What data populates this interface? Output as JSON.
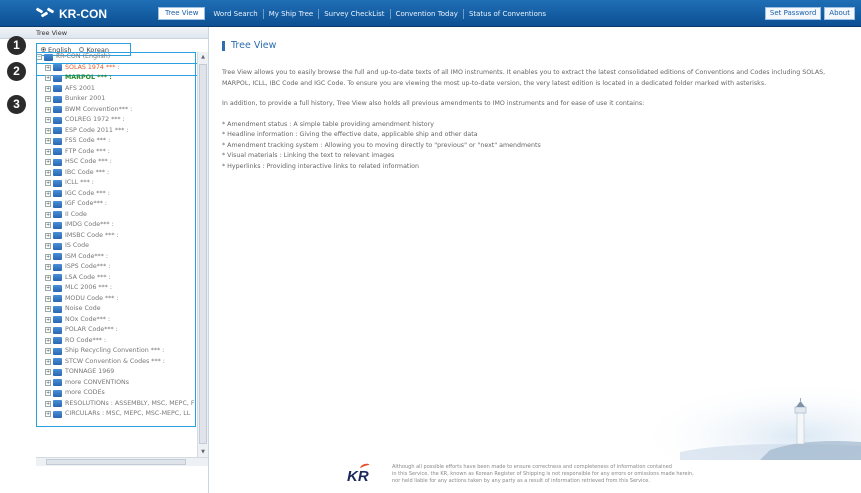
{
  "app": {
    "name": "KR-CON"
  },
  "nav": {
    "items": [
      "Tree View",
      "Word Search",
      "My Ship Tree",
      "Survey CheckList",
      "Convention Today",
      "Status of Conventions"
    ],
    "active": "Tree View"
  },
  "top_right": {
    "set_password": "Set Password",
    "about": "About"
  },
  "left": {
    "title": "Tree View",
    "lang_options": [
      "English",
      "Korean"
    ],
    "lang_selected": "English",
    "search_placeholder": "",
    "markers": [
      "1",
      "2",
      "3"
    ],
    "tree": {
      "root": "KR-CON (English)",
      "items": [
        {
          "label": "SOLAS 1974 *** :",
          "color": "red"
        },
        {
          "label": "MARPOL *** :",
          "color": "green"
        },
        {
          "label": "AFS 2001",
          "color": "gray"
        },
        {
          "label": "Bunker 2001",
          "color": "gray"
        },
        {
          "label": "BWM Convention*** :",
          "color": "gray"
        },
        {
          "label": "COLREG 1972 *** :",
          "color": "gray"
        },
        {
          "label": "ESP Code 2011 *** :",
          "color": "gray"
        },
        {
          "label": "FSS Code *** :",
          "color": "gray"
        },
        {
          "label": "FTP Code *** :",
          "color": "gray"
        },
        {
          "label": "HSC Code *** :",
          "color": "gray"
        },
        {
          "label": "IBC Code *** :",
          "color": "gray"
        },
        {
          "label": "ICLL *** :",
          "color": "gray"
        },
        {
          "label": "IGC Code *** :",
          "color": "gray"
        },
        {
          "label": "IGF Code*** :",
          "color": "gray"
        },
        {
          "label": "II Code",
          "color": "gray"
        },
        {
          "label": "IMDG Code*** :",
          "color": "gray"
        },
        {
          "label": "IMSBC Code *** :",
          "color": "gray"
        },
        {
          "label": "IS Code",
          "color": "gray"
        },
        {
          "label": "ISM Code*** :",
          "color": "gray"
        },
        {
          "label": "ISPS Code*** :",
          "color": "gray"
        },
        {
          "label": "LSA Code *** :",
          "color": "gray"
        },
        {
          "label": "MLC 2006 *** :",
          "color": "gray"
        },
        {
          "label": "MODU Code *** :",
          "color": "gray"
        },
        {
          "label": "Noise Code",
          "color": "gray"
        },
        {
          "label": "NOx Code*** :",
          "color": "gray"
        },
        {
          "label": "POLAR Code*** :",
          "color": "gray"
        },
        {
          "label": "RO Code*** :",
          "color": "gray"
        },
        {
          "label": "Ship Recycling Convention *** :",
          "color": "gray"
        },
        {
          "label": "STCW Convention & Codes *** :",
          "color": "gray"
        },
        {
          "label": "TONNAGE 1969",
          "color": "gray"
        },
        {
          "label": "more CONVENTIONs",
          "color": "gray"
        },
        {
          "label": "more CODEs",
          "color": "gray"
        },
        {
          "label": "RESOLUTIONs : ASSEMBLY, MSC, MEPC, F",
          "color": "gray"
        },
        {
          "label": "CIRCULARs : MSC, MEPC, MSC-MEPC, LL",
          "color": "gray"
        }
      ]
    }
  },
  "content": {
    "title": "Tree View",
    "paragraph1": "Tree View allows you to easily browse the full and up-to-date texts of all IMO instruments. It enables you to extract the latest consolidated editions of Conventions and Codes including SOLAS, MARPOL, ICLL, IBC Code and IGC Code. To ensure you are viewing the most up-to-date version, the very latest edition is located in a dedicated folder marked with asterisks.",
    "paragraph2": "In addition, to provide a full history, Tree View also holds all previous amendments to IMO instruments and for ease of use it contains:",
    "bullets": [
      "* Amendment status : A simple table providing amendment history",
      "* Headline information : Giving the effective date, applicable ship and other data",
      "* Amendment tracking system : Allowing you to moving directly to \"previous\" or \"next\" amendments",
      "* Visual materials : Linking the text to relevant images",
      "* Hyperlinks : Providing interactive links to related information"
    ]
  },
  "footer": {
    "logo": "KR",
    "disclaimer": [
      "Although all possible efforts have been made to ensure correctness and completeness of information contained",
      "in this Service, the KR, known as Korean Register of Shipping is not responsible for any errors or omissions made herein,",
      "nor held liable for any actions taken by any party as a result of information retrieved from this Service."
    ]
  },
  "colors": {
    "topbar": "#15599e",
    "highlight": "#2aa0e0",
    "accent": "#2e6db0",
    "solas": "#e05a2a",
    "marpol": "#1d8a2a"
  }
}
